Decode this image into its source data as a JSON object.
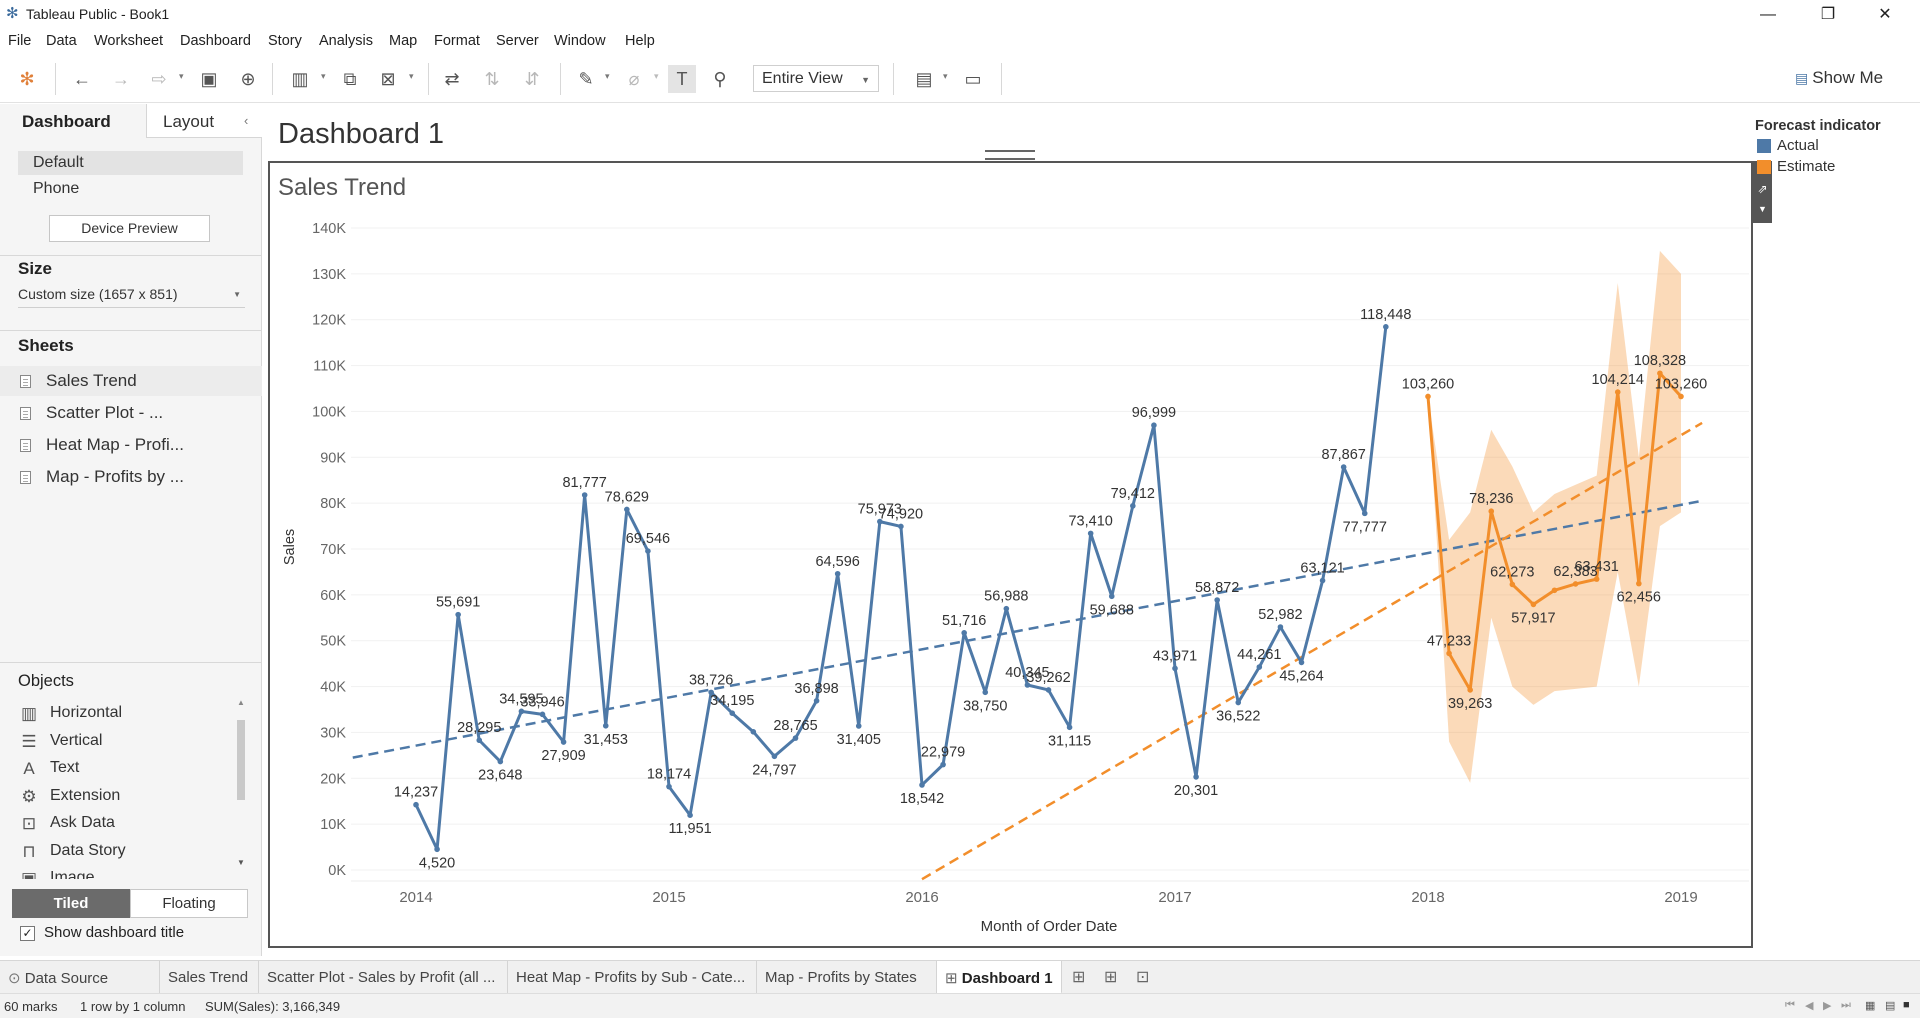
{
  "window": {
    "title": "Tableau Public - Book1",
    "logo_icon": "tableau-logo-icon",
    "minimize": "—",
    "restore": "❐",
    "close": "✕"
  },
  "menu": [
    "File",
    "Data",
    "Worksheet",
    "Dashboard",
    "Story",
    "Analysis",
    "Map",
    "Format",
    "Server",
    "Window",
    "Help"
  ],
  "toolbar": {
    "fit_select": "Entire View",
    "show_me": "Show Me"
  },
  "left_pane": {
    "tab_dashboard": "Dashboard",
    "tab_layout": "Layout",
    "collapse_icon": "‹",
    "devices": [
      "Default",
      "Phone"
    ],
    "device_preview": "Device Preview",
    "size_header": "Size",
    "size_value": "Custom size (1657 x 851)",
    "sheets_header": "Sheets",
    "sheets": [
      "Sales Trend",
      "Scatter Plot - ...",
      "Heat Map - Profi...",
      "Map - Profits by ..."
    ],
    "objects_header": "Objects",
    "objects": [
      {
        "label": "Horizontal",
        "icon": "horizontal-layout-icon"
      },
      {
        "label": "Vertical",
        "icon": "vertical-layout-icon"
      },
      {
        "label": "Text",
        "icon": "text-icon"
      },
      {
        "label": "Extension",
        "icon": "extension-icon"
      },
      {
        "label": "Ask Data",
        "icon": "ask-data-icon"
      },
      {
        "label": "Data Story",
        "icon": "data-story-icon"
      },
      {
        "label": "Image",
        "icon": "image-icon"
      }
    ],
    "tiled": "Tiled",
    "floating": "Floating",
    "show_title": "Show dashboard title",
    "show_title_checked": true
  },
  "dashboard": {
    "title": "Dashboard 1",
    "sheet_title": "Sales Trend"
  },
  "legend": {
    "title": "Forecast indicator",
    "items": [
      {
        "label": "Actual",
        "color": "#4e79a7"
      },
      {
        "label": "Estimate",
        "color": "#f28e2b"
      }
    ]
  },
  "bottom_tabs": {
    "data_source": "Data Source",
    "tabs": [
      "Sales Trend",
      "Scatter Plot - Sales by Profit (all ...",
      "Heat Map - Profits by Sub - Cate...",
      "Map - Profits by States"
    ],
    "active": "Dashboard 1"
  },
  "status": {
    "marks": "60 marks",
    "rows": "1 row by 1 column",
    "sum": "SUM(Sales): 3,166,349"
  },
  "chart_data": {
    "type": "line",
    "title": "Sales Trend",
    "xlabel": "Month of Order Date",
    "ylabel": "Sales",
    "x_ticks": [
      "2014",
      "2015",
      "2016",
      "2017",
      "2018",
      "2019"
    ],
    "y_ticks": [
      "0K",
      "10K",
      "20K",
      "30K",
      "40K",
      "50K",
      "60K",
      "70K",
      "80K",
      "90K",
      "100K",
      "110K",
      "120K",
      "130K",
      "140K"
    ],
    "ylim": [
      0,
      140000
    ],
    "x_unit": "months since Jan 2014",
    "series": [
      {
        "name": "Actual",
        "color": "#4e79a7",
        "points": [
          {
            "month": "2014-01",
            "value": 14237
          },
          {
            "month": "2014-02",
            "value": 4520
          },
          {
            "month": "2014-03",
            "value": 55691
          },
          {
            "month": "2014-04",
            "value": 28295
          },
          {
            "month": "2014-05",
            "value": 23648
          },
          {
            "month": "2014-06",
            "value": 34595
          },
          {
            "month": "2014-07",
            "value": 33946
          },
          {
            "month": "2014-08",
            "value": 27909
          },
          {
            "month": "2014-09",
            "value": 81777
          },
          {
            "month": "2014-10",
            "value": 31453
          },
          {
            "month": "2014-11",
            "value": 78629
          },
          {
            "month": "2014-12",
            "value": 69546
          },
          {
            "month": "2015-01",
            "value": 18174
          },
          {
            "month": "2015-02",
            "value": 11951
          },
          {
            "month": "2015-03",
            "value": 38726
          },
          {
            "month": "2015-04",
            "value": 34195
          },
          {
            "month": "2015-05",
            "value": 30131
          },
          {
            "month": "2015-06",
            "value": 24797
          },
          {
            "month": "2015-07",
            "value": 28765
          },
          {
            "month": "2015-08",
            "value": 36898
          },
          {
            "month": "2015-09",
            "value": 64596
          },
          {
            "month": "2015-10",
            "value": 31405
          },
          {
            "month": "2015-11",
            "value": 75973
          },
          {
            "month": "2015-12",
            "value": 74920
          },
          {
            "month": "2016-01",
            "value": 18542
          },
          {
            "month": "2016-02",
            "value": 22979
          },
          {
            "month": "2016-03",
            "value": 51716
          },
          {
            "month": "2016-04",
            "value": 38750
          },
          {
            "month": "2016-05",
            "value": 56988
          },
          {
            "month": "2016-06",
            "value": 40345
          },
          {
            "month": "2016-07",
            "value": 39262
          },
          {
            "month": "2016-08",
            "value": 31115
          },
          {
            "month": "2016-09",
            "value": 73410
          },
          {
            "month": "2016-10",
            "value": 59688
          },
          {
            "month": "2016-11",
            "value": 79412
          },
          {
            "month": "2016-12",
            "value": 96999
          },
          {
            "month": "2017-01",
            "value": 43971
          },
          {
            "month": "2017-02",
            "value": 20301
          },
          {
            "month": "2017-03",
            "value": 58872
          },
          {
            "month": "2017-04",
            "value": 36522
          },
          {
            "month": "2017-05",
            "value": 44261
          },
          {
            "month": "2017-06",
            "value": 52982
          },
          {
            "month": "2017-07",
            "value": 45264
          },
          {
            "month": "2017-08",
            "value": 63121
          },
          {
            "month": "2017-09",
            "value": 87867
          },
          {
            "month": "2017-10",
            "value": 77777
          },
          {
            "month": "2017-11",
            "value": 118448
          }
        ]
      },
      {
        "name": "Estimate",
        "color": "#f28e2b",
        "points": [
          {
            "month": "2018-01",
            "value": 103260
          },
          {
            "month": "2018-02",
            "value": 47233
          },
          {
            "month": "2018-03",
            "value": 39263
          },
          {
            "month": "2018-04",
            "value": 78236
          },
          {
            "month": "2018-05",
            "value": 62273
          },
          {
            "month": "2018-06",
            "value": 57917
          },
          {
            "month": "2018-07",
            "value": 61000
          },
          {
            "month": "2018-08",
            "value": 62383
          },
          {
            "month": "2018-09",
            "value": 63431
          },
          {
            "month": "2018-10",
            "value": 104214
          },
          {
            "month": "2018-11",
            "value": 62456
          },
          {
            "month": "2018-12",
            "value": 108328
          },
          {
            "month": "2019-01",
            "value": 103260
          }
        ],
        "band": {
          "upper": [
            103260,
            72000,
            78000,
            96000,
            88000,
            78000,
            82000,
            84000,
            86000,
            128000,
            90000,
            135000,
            130000
          ],
          "lower": [
            103260,
            28000,
            19000,
            55000,
            40000,
            36000,
            39000,
            39500,
            40000,
            65000,
            40000,
            75000,
            78000
          ]
        }
      }
    ],
    "data_labels": [
      {
        "text": "14,237",
        "series": "Actual",
        "month": "2014-01"
      },
      {
        "text": "4,520",
        "series": "Actual",
        "month": "2014-02"
      },
      {
        "text": "55,691",
        "series": "Actual",
        "month": "2014-03"
      },
      {
        "text": "28,295",
        "series": "Actual",
        "month": "2014-04"
      },
      {
        "text": "23,648",
        "series": "Actual",
        "month": "2014-05"
      },
      {
        "text": "34,595",
        "series": "Actual",
        "month": "2014-06"
      },
      {
        "text": "33,946",
        "series": "Actual",
        "month": "2014-07"
      },
      {
        "text": "27,909",
        "series": "Actual",
        "month": "2014-08"
      },
      {
        "text": "81,777",
        "series": "Actual",
        "month": "2014-09"
      },
      {
        "text": "31,453",
        "series": "Actual",
        "month": "2014-10"
      },
      {
        "text": "78,629",
        "series": "Actual",
        "month": "2014-11"
      },
      {
        "text": "69,546",
        "series": "Actual",
        "month": "2014-12"
      },
      {
        "text": "18,174",
        "series": "Actual",
        "month": "2015-01"
      },
      {
        "text": "11,951",
        "series": "Actual",
        "month": "2015-02"
      },
      {
        "text": "38,726",
        "series": "Actual",
        "month": "2015-03"
      },
      {
        "text": "34,195",
        "series": "Actual",
        "month": "2015-04"
      },
      {
        "text": "24,797",
        "series": "Actual",
        "month": "2015-06"
      },
      {
        "text": "28,765",
        "series": "Actual",
        "month": "2015-07"
      },
      {
        "text": "36,898",
        "series": "Actual",
        "month": "2015-08"
      },
      {
        "text": "64,596",
        "series": "Actual",
        "month": "2015-09"
      },
      {
        "text": "31,405",
        "series": "Actual",
        "month": "2015-10"
      },
      {
        "text": "75,973",
        "series": "Actual",
        "month": "2015-11"
      },
      {
        "text": "74,920",
        "series": "Actual",
        "month": "2015-12"
      },
      {
        "text": "18,542",
        "series": "Actual",
        "month": "2016-01"
      },
      {
        "text": "22,979",
        "series": "Actual",
        "month": "2016-02"
      },
      {
        "text": "51,716",
        "series": "Actual",
        "month": "2016-03"
      },
      {
        "text": "38,750",
        "series": "Actual",
        "month": "2016-04"
      },
      {
        "text": "56,988",
        "series": "Actual",
        "month": "2016-05"
      },
      {
        "text": "40,345",
        "series": "Actual",
        "month": "2016-06"
      },
      {
        "text": "39,262",
        "series": "Actual",
        "month": "2016-07"
      },
      {
        "text": "31,115",
        "series": "Actual",
        "month": "2016-08"
      },
      {
        "text": "73,410",
        "series": "Actual",
        "month": "2016-09"
      },
      {
        "text": "59,688",
        "series": "Actual",
        "month": "2016-10"
      },
      {
        "text": "79,412",
        "series": "Actual",
        "month": "2016-11"
      },
      {
        "text": "96,999",
        "series": "Actual",
        "month": "2016-12"
      },
      {
        "text": "43,971",
        "series": "Actual",
        "month": "2017-01"
      },
      {
        "text": "20,301",
        "series": "Actual",
        "month": "2017-02"
      },
      {
        "text": "58,872",
        "series": "Actual",
        "month": "2017-03"
      },
      {
        "text": "36,522",
        "series": "Actual",
        "month": "2017-04"
      },
      {
        "text": "44,261",
        "series": "Actual",
        "month": "2017-05"
      },
      {
        "text": "52,982",
        "series": "Actual",
        "month": "2017-06"
      },
      {
        "text": "45,264",
        "series": "Actual",
        "month": "2017-07"
      },
      {
        "text": "63,121",
        "series": "Actual",
        "month": "2017-08"
      },
      {
        "text": "87,867",
        "series": "Actual",
        "month": "2017-09"
      },
      {
        "text": "77,777",
        "series": "Actual",
        "month": "2017-10"
      },
      {
        "text": "118,448",
        "series": "Actual",
        "month": "2017-11"
      },
      {
        "text": "103,260",
        "series": "Estimate",
        "month": "2018-01"
      },
      {
        "text": "47,233",
        "series": "Estimate",
        "month": "2018-02"
      },
      {
        "text": "39,263",
        "series": "Estimate",
        "month": "2018-03"
      },
      {
        "text": "78,236",
        "series": "Estimate",
        "month": "2018-04"
      },
      {
        "text": "62,273",
        "series": "Estimate",
        "month": "2018-05"
      },
      {
        "text": "57,917",
        "series": "Estimate",
        "month": "2018-06"
      },
      {
        "text": "62,383",
        "series": "Estimate",
        "month": "2018-08"
      },
      {
        "text": "63,431",
        "series": "Estimate",
        "month": "2018-09"
      },
      {
        "text": "104,214",
        "series": "Estimate",
        "month": "2018-10"
      },
      {
        "text": "62,456",
        "series": "Estimate",
        "month": "2018-11"
      },
      {
        "text": "108,328",
        "series": "Estimate",
        "month": "2018-12"
      },
      {
        "text": "103,260",
        "series": "Estimate",
        "month": "2019-01"
      }
    ],
    "trend_lines": [
      {
        "series": "Actual",
        "style": "dashed",
        "start": {
          "month": "2013-10",
          "value": 24500
        },
        "end": {
          "month": "2019-02",
          "value": 80500
        }
      },
      {
        "series": "Estimate",
        "style": "dashed",
        "start": {
          "month": "2016-01",
          "value": -2000
        },
        "end": {
          "month": "2019-02",
          "value": 97500
        }
      }
    ],
    "legend_position": "right"
  }
}
